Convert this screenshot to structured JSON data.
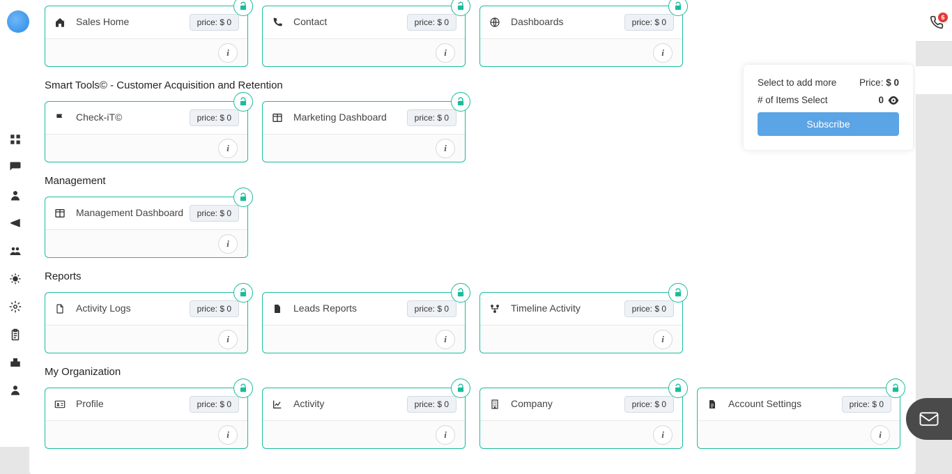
{
  "price_prefix": "price:",
  "currency": "$",
  "notification_count": "6",
  "sections": [
    {
      "title": "",
      "cards": [
        {
          "label": "Sales Home",
          "price": "0",
          "icon": "home"
        },
        {
          "label": "Contact",
          "price": "0",
          "icon": "phone"
        },
        {
          "label": "Dashboards",
          "price": "0",
          "icon": "globe"
        }
      ]
    },
    {
      "title": "Smart Tools© - Customer Acquisition and Retention",
      "cards": [
        {
          "label": "Check-iT©",
          "price": "0",
          "icon": "flag"
        },
        {
          "label": "Marketing Dashboard",
          "price": "0",
          "icon": "columns"
        }
      ]
    },
    {
      "title": "Management",
      "cards": [
        {
          "label": "Management Dashboard",
          "price": "0",
          "icon": "columns"
        }
      ]
    },
    {
      "title": "Reports",
      "cards": [
        {
          "label": "Activity Logs",
          "price": "0",
          "icon": "file"
        },
        {
          "label": "Leads Reports",
          "price": "0",
          "icon": "file-solid"
        },
        {
          "label": "Timeline Activity",
          "price": "0",
          "icon": "nodes"
        }
      ]
    },
    {
      "title": "My Organization",
      "cards": [
        {
          "label": "Profile",
          "price": "0",
          "icon": "id-card"
        },
        {
          "label": "Activity",
          "price": "0",
          "icon": "chart-line"
        },
        {
          "label": "Company",
          "price": "0",
          "icon": "building"
        },
        {
          "label": "Account Settings",
          "price": "0",
          "icon": "file-lines"
        }
      ]
    }
  ],
  "summary": {
    "select_label": "Select to add more",
    "price_label": "Price:",
    "price_value": "$ 0",
    "count_label": "# of Items Select",
    "count_value": "0",
    "subscribe_label": "Subscribe"
  }
}
